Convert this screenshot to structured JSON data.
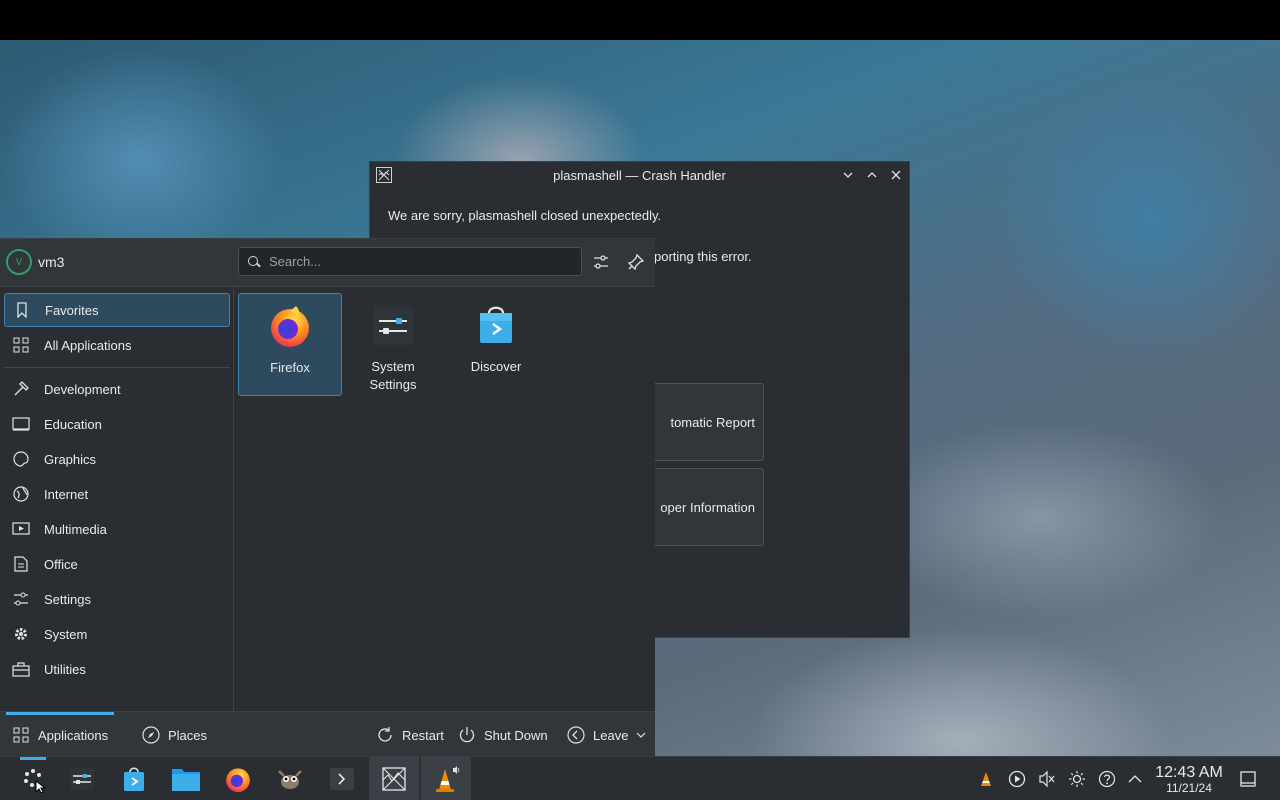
{
  "crash_dialog": {
    "title": "plasmashell — Crash Handler",
    "message": "We are sorry, plasmashell closed unexpectedly.",
    "message_partial": "porting this error.",
    "buttons": [
      "tomatic Report",
      "oper Information"
    ]
  },
  "launcher": {
    "user": {
      "name": "vm3",
      "avatar_letter": "V"
    },
    "search": {
      "placeholder": "Search..."
    },
    "categories": [
      {
        "label": "Favorites",
        "icon": "bookmark-icon",
        "active": true
      },
      {
        "label": "All Applications",
        "icon": "grid-icon",
        "active": false
      },
      {
        "label": "Development",
        "icon": "hammer-icon",
        "active": false
      },
      {
        "label": "Education",
        "icon": "monitor-icon",
        "active": false
      },
      {
        "label": "Graphics",
        "icon": "palette-icon",
        "active": false
      },
      {
        "label": "Internet",
        "icon": "globe-icon",
        "active": false
      },
      {
        "label": "Multimedia",
        "icon": "media-icon",
        "active": false
      },
      {
        "label": "Office",
        "icon": "document-icon",
        "active": false
      },
      {
        "label": "Settings",
        "icon": "sliders-icon",
        "active": false
      },
      {
        "label": "System",
        "icon": "gear-icon",
        "active": false
      },
      {
        "label": "Utilities",
        "icon": "toolbox-icon",
        "active": false
      }
    ],
    "favorites": [
      {
        "label": "Firefox",
        "icon": "firefox-icon"
      },
      {
        "label": "System Settings",
        "icon": "system-settings-icon"
      },
      {
        "label": "Discover",
        "icon": "discover-icon"
      }
    ],
    "footer": {
      "applications": "Applications",
      "places": "Places",
      "restart": "Restart",
      "shutdown": "Shut Down",
      "leave": "Leave"
    }
  },
  "taskbar": {
    "items": [
      "application-launcher-icon",
      "system-settings-icon",
      "discover-icon",
      "files-icon",
      "firefox-icon",
      "gimp-icon",
      "terminal-icon",
      "crash-handler-icon",
      "vlc-icon"
    ],
    "clock": {
      "time": "12:43 AM",
      "date": "11/21/24"
    }
  },
  "colors": {
    "accent": "#3daee9",
    "panel": "#2a2e32",
    "selection": "#2d4a5e"
  }
}
